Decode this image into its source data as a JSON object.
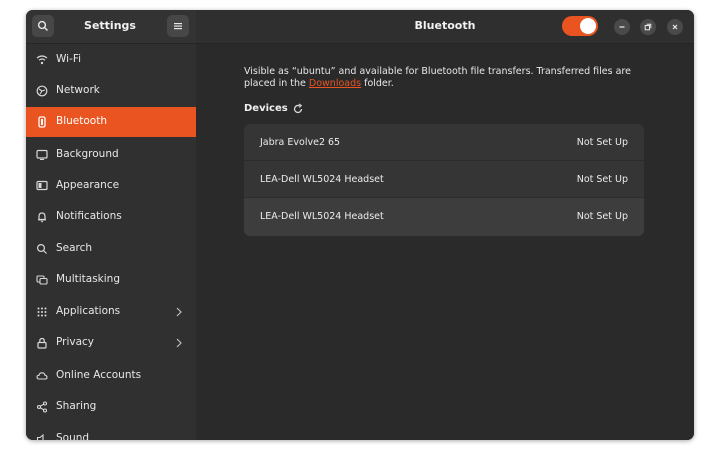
{
  "window": {
    "sidebar_title": "Settings",
    "main_title": "Bluetooth",
    "bluetooth_enabled": true,
    "accent_color": "#e95420"
  },
  "sidebar": {
    "items": [
      {
        "label": "Wi-Fi",
        "icon": "wifi-icon"
      },
      {
        "label": "Network",
        "icon": "network-icon"
      },
      {
        "label": "Bluetooth",
        "icon": "bluetooth-icon",
        "active": true
      },
      {
        "label": "Background",
        "icon": "background-icon"
      },
      {
        "label": "Appearance",
        "icon": "appearance-icon"
      },
      {
        "label": "Notifications",
        "icon": "bell-icon"
      },
      {
        "label": "Search",
        "icon": "search-icon"
      },
      {
        "label": "Multitasking",
        "icon": "multitasking-icon"
      },
      {
        "label": "Applications",
        "icon": "apps-grid-icon",
        "has_submenu": true
      },
      {
        "label": "Privacy",
        "icon": "lock-icon",
        "has_submenu": true
      },
      {
        "label": "Online Accounts",
        "icon": "cloud-icon"
      },
      {
        "label": "Sharing",
        "icon": "share-icon"
      },
      {
        "label": "Sound",
        "icon": "speaker-icon"
      }
    ]
  },
  "bluetooth": {
    "intro_part1": "Visible as “ubuntu” and available for Bluetooth file transfers. Transferred files are placed in the ",
    "intro_link": "Downloads",
    "intro_part2": " folder.",
    "devices_label": "Devices",
    "devices": [
      {
        "name": "Jabra Evolve2 65",
        "status": "Not Set Up"
      },
      {
        "name": "LEA-Dell WL5024 Headset",
        "status": "Not Set Up"
      },
      {
        "name": "LEA-Dell WL5024 Headset",
        "status": "Not Set Up"
      }
    ]
  }
}
